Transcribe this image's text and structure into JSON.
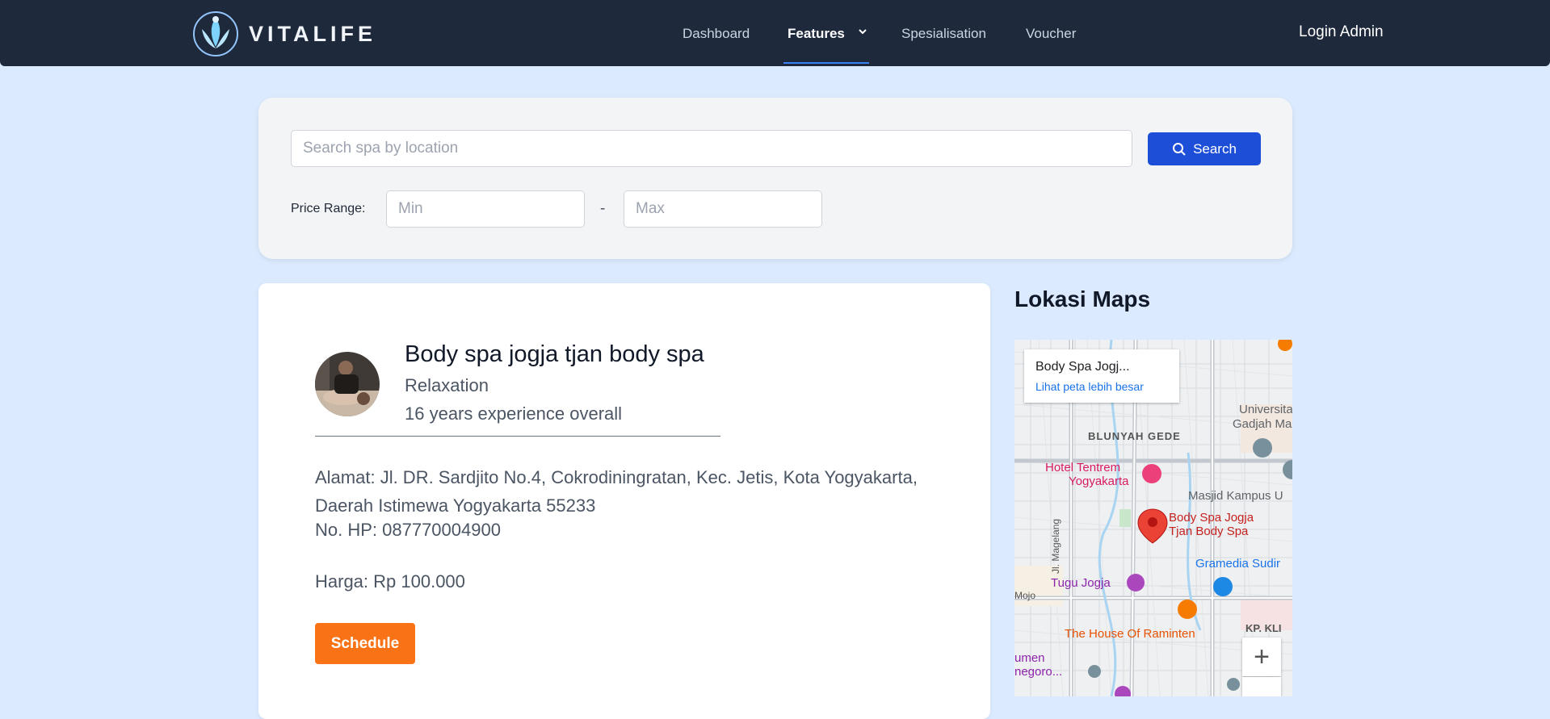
{
  "brand": {
    "name": "VITALIFE",
    "logo_icon": "lotus-icon"
  },
  "nav": {
    "items": [
      {
        "label": "Dashboard"
      },
      {
        "label": "Features",
        "active": true,
        "has_dropdown": true
      },
      {
        "label": "Spesialisation"
      },
      {
        "label": "Voucher"
      }
    ],
    "login_label": "Login Admin"
  },
  "search": {
    "placeholder": "Search spa by location",
    "button_label": "Search",
    "price_label": "Price Range:",
    "min_placeholder": "Min",
    "max_placeholder": "Max",
    "dash": "-"
  },
  "spa": {
    "name": "Body spa jogja tjan body spa",
    "category": "Relaxation",
    "experience": "16 years experience overall",
    "address": "Alamat: Jl. DR. Sardjito No.4, Cokrodiningratan, Kec. Jetis, Kota Yogyakarta, Daerah Istimewa Yogyakarta 55233",
    "phone": "No. HP: 087770004900",
    "price": "Harga: Rp 100.000",
    "schedule_label": "Schedule"
  },
  "maps": {
    "title": "Lokasi Maps",
    "info_title": "Body Spa Jogj...",
    "info_link": "Lihat peta lebih besar",
    "labels": {
      "blunyah": "BLUNYAH GEDE",
      "univ1": "Universitas",
      "univ2": "Gadjah Mad",
      "hotel1": "Hotel Tentrem",
      "hotel2": "Yogyakarta",
      "masjid": "Masjid Kampus U",
      "spa1": "Body Spa Jogja",
      "spa2": "Tjan Body Spa",
      "magelang": "Jl. Magelang",
      "gramedia": "Gramedia Sudir",
      "tugu": "Tugu Jogja",
      "mojo": "Mojo",
      "raminten": "The House Of Raminten",
      "kpkli": "KP. KLI",
      "umen": "umen",
      "negoro": "negoro..."
    },
    "zoom_in": "+"
  }
}
